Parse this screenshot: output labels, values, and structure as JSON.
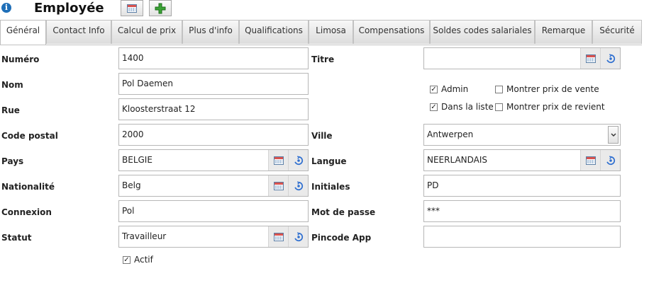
{
  "header": {
    "title": "Employée"
  },
  "tabs": [
    {
      "label": "Général"
    },
    {
      "label": "Contact Info"
    },
    {
      "label": "Calcul de prix"
    },
    {
      "label": "Plus d'info"
    },
    {
      "label": "Qualifications"
    },
    {
      "label": "Limosa"
    },
    {
      "label": "Compensations"
    },
    {
      "label": "Soldes codes salariales"
    },
    {
      "label": "Remarque"
    },
    {
      "label": "Sécurité"
    }
  ],
  "form": {
    "numero": {
      "label": "Numéro",
      "value": "1400"
    },
    "nom": {
      "label": "Nom",
      "value": "Pol Daemen"
    },
    "rue": {
      "label": "Rue",
      "value": "Kloosterstraat 12"
    },
    "code_postal": {
      "label": "Code postal",
      "value": "2000"
    },
    "pays": {
      "label": "Pays",
      "value": "BELGIE"
    },
    "nationalite": {
      "label": "Nationalité",
      "value": "Belg"
    },
    "connexion": {
      "label": "Connexion",
      "value": "Pol"
    },
    "statut": {
      "label": "Statut",
      "value": "Travailleur"
    },
    "actif": {
      "label": "Actif",
      "checked": true
    },
    "titre": {
      "label": "Titre",
      "value": ""
    },
    "admin": {
      "label": "Admin",
      "checked": true
    },
    "dans_la_liste": {
      "label": "Dans la liste",
      "checked": true
    },
    "montrer_prix_vente": {
      "label": "Montrer prix de vente",
      "checked": false
    },
    "montrer_prix_revient": {
      "label": "Montrer prix de revient",
      "checked": false
    },
    "ville": {
      "label": "Ville",
      "value": "Antwerpen"
    },
    "langue": {
      "label": "Langue",
      "value": "NEERLANDAIS"
    },
    "initiales": {
      "label": "Initiales",
      "value": "PD"
    },
    "mot_de_passe": {
      "label": "Mot de passe",
      "value": "***"
    },
    "pincode_app": {
      "label": "Pincode App",
      "value": ""
    }
  },
  "icons": {
    "info": "info-icon",
    "calendar": "calendar-icon",
    "add": "add-icon",
    "refresh": "refresh-icon",
    "chevron": "chevron-down-icon",
    "check": "✓"
  },
  "colors": {
    "add_green": "#3aa335",
    "info_blue": "#1f6fb8",
    "refresh_blue": "#2f6fd0"
  }
}
